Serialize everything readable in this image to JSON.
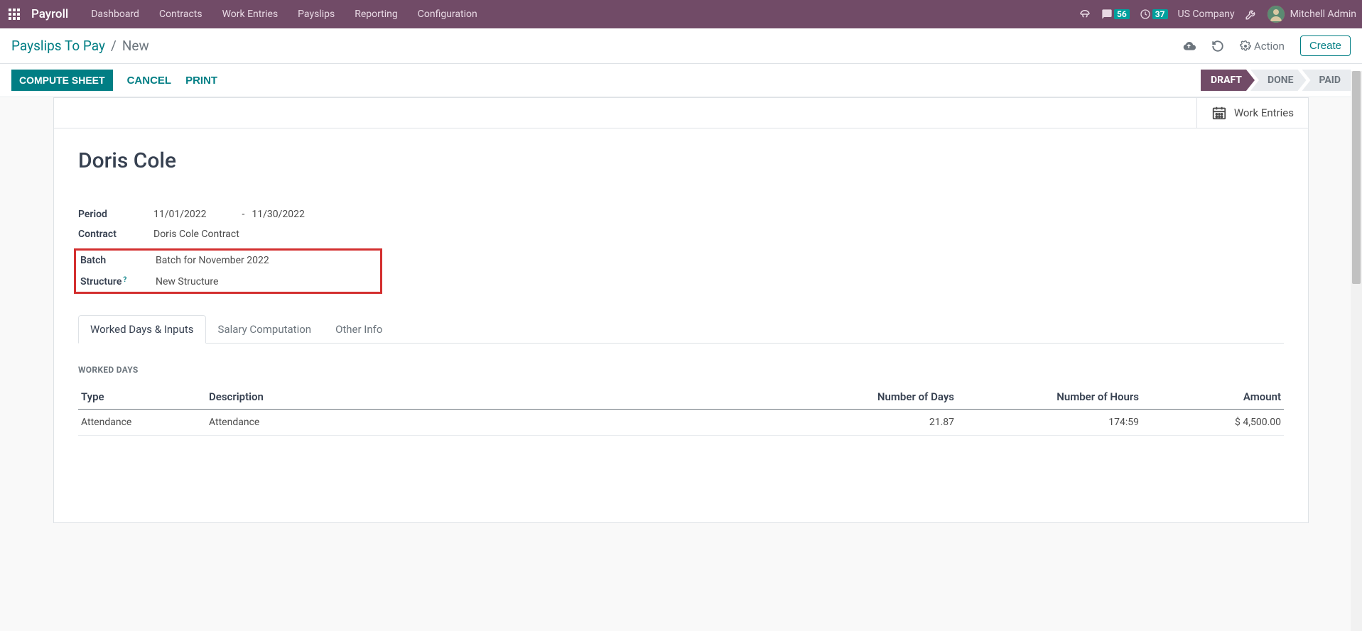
{
  "nav": {
    "brand": "Payroll",
    "links": [
      "Dashboard",
      "Contracts",
      "Work Entries",
      "Payslips",
      "Reporting",
      "Configuration"
    ],
    "chat_count": "56",
    "clock_count": "37",
    "company": "US Company",
    "user": "Mitchell Admin"
  },
  "breadcrumb": {
    "parent": "Payslips To Pay",
    "current": "New",
    "action": "Action",
    "create": "Create"
  },
  "statusbar": {
    "compute": "COMPUTE SHEET",
    "cancel": "CANCEL",
    "print": "PRINT",
    "stages": [
      "DRAFT",
      "DONE",
      "PAID"
    ]
  },
  "sheet": {
    "work_entries_btn": "Work Entries",
    "employee": "Doris Cole",
    "fields": {
      "period_label": "Period",
      "period_from": "11/01/2022",
      "period_sep": "-",
      "period_to": "11/30/2022",
      "contract_label": "Contract",
      "contract_value": "Doris Cole Contract",
      "batch_label": "Batch",
      "batch_value": "Batch for November 2022",
      "structure_label": "Structure",
      "structure_help": "?",
      "structure_value": "New Structure"
    },
    "tabs": [
      "Worked Days & Inputs",
      "Salary Computation",
      "Other Info"
    ],
    "section_title": "WORKED DAYS",
    "table": {
      "headers": [
        "Type",
        "Description",
        "Number of Days",
        "Number of Hours",
        "Amount"
      ],
      "row": {
        "type": "Attendance",
        "description": "Attendance",
        "days": "21.87",
        "hours": "174:59",
        "amount": "$ 4,500.00"
      }
    }
  }
}
